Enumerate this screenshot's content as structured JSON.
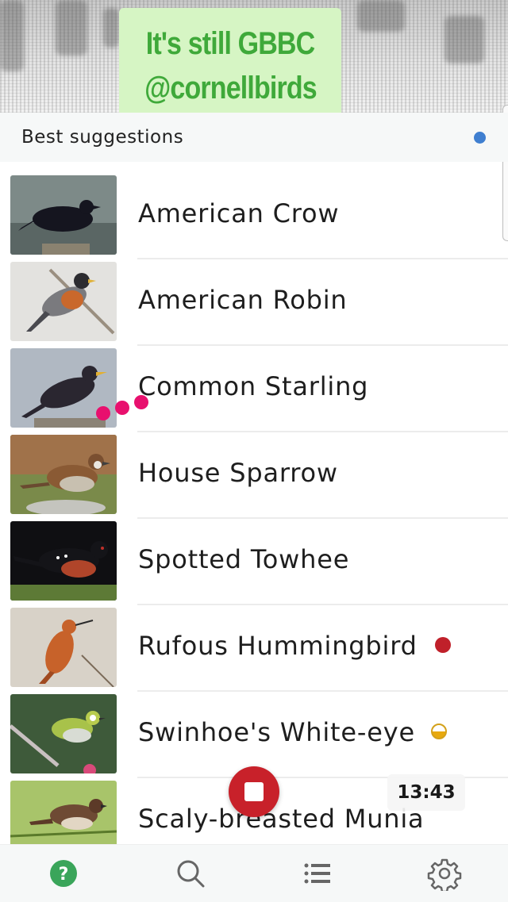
{
  "overlay": {
    "line1": "It's still GBBC",
    "line2": "@cornellbirds"
  },
  "section": {
    "title": "Best suggestions",
    "indicator_color": "#3f7fd0"
  },
  "birds": [
    {
      "name": "American Crow",
      "badge": null
    },
    {
      "name": "American Robin",
      "badge": null
    },
    {
      "name": "Common Starling",
      "badge": null
    },
    {
      "name": "House Sparrow",
      "badge": null
    },
    {
      "name": "Spotted Towhee",
      "badge": null
    },
    {
      "name": "Rufous Hummingbird",
      "badge": "red-dot"
    },
    {
      "name": "Swinhoe's White-eye",
      "badge": "half-circle-yellow"
    },
    {
      "name": "Scaly-breasted Munia",
      "badge": null
    }
  ],
  "recording": {
    "button_icon": "stop-icon",
    "elapsed": "13:43",
    "color": "#c8212a"
  },
  "bottom_nav": {
    "items": [
      {
        "icon": "help-icon",
        "active": true
      },
      {
        "icon": "search-icon",
        "active": false
      },
      {
        "icon": "list-icon",
        "active": false
      },
      {
        "icon": "settings-icon",
        "active": false
      }
    ],
    "active_color": "#3aa55a"
  }
}
